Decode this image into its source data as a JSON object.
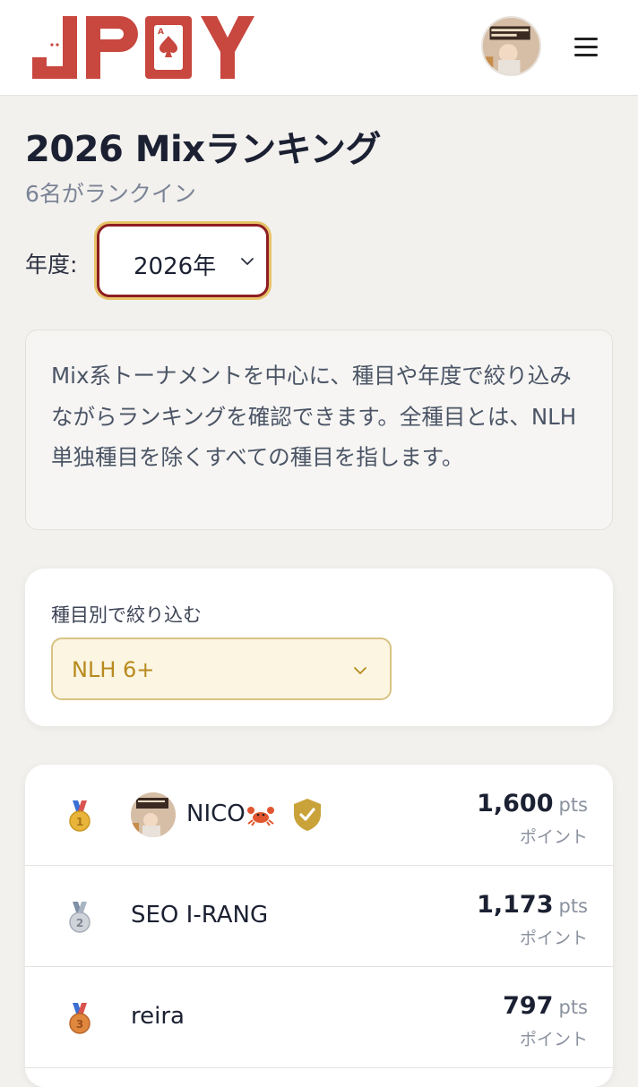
{
  "header": {
    "logo_text": "JPOY",
    "brand_color": "#c8473f"
  },
  "page": {
    "title": "2026 Mixランキング",
    "subtitle": "6名がランクイン"
  },
  "year_filter": {
    "label": "年度:",
    "selected": "2026年"
  },
  "info": {
    "text": "Mix系トーナメントを中心に、種目や年度で絞り込みながらランキングを確認できます。全種目とは、NLH単独種目を除くすべての種目を指します。"
  },
  "event_filter": {
    "label": "種目別で絞り込む",
    "selected": "NLH 6+"
  },
  "ranking": {
    "rows": [
      {
        "medal": "gold-medal-icon",
        "name": "NICO",
        "has_avatar": true,
        "verified": true,
        "points": "1,600",
        "unit": "pts",
        "caption": "ポイント"
      },
      {
        "medal": "silver-medal-icon",
        "name": "SEO I-RANG",
        "has_avatar": false,
        "verified": false,
        "points": "1,173",
        "unit": "pts",
        "caption": "ポイント"
      },
      {
        "medal": "bronze-medal-icon",
        "name": "reira",
        "has_avatar": false,
        "verified": false,
        "points": "797",
        "unit": "pts",
        "caption": "ポイント"
      }
    ]
  },
  "colors": {
    "accent": "#8d1d22",
    "gold": "#c9a23a",
    "filter_bg": "#fbf5e1"
  }
}
